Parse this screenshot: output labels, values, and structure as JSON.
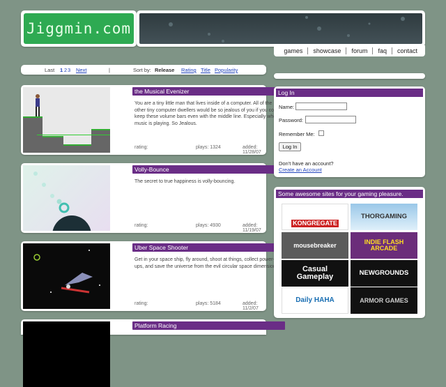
{
  "header": {
    "logo": "Jiggmin.com",
    "nav": [
      "games",
      "showcase",
      "forum",
      "faq",
      "contact"
    ]
  },
  "sortbar": {
    "last": "Last",
    "pages": [
      "1",
      "2",
      "3"
    ],
    "next": "Next",
    "divider": "|",
    "sort_by": "Sort by:",
    "options": [
      "Release",
      "Rating",
      "Title",
      "Popularity"
    ]
  },
  "games": [
    {
      "title": "the Musical Evenizer",
      "description": "You are a tiny little man that lives inside of a computer. All of the other tiny computer dwellers would be so jealous of you if you could keep these volume bars even with the middle line. Especially when music is playing. So Jealous.",
      "rating": "rating:",
      "plays": "plays: 1324",
      "added": "added: 11/28/07"
    },
    {
      "title": "Volly-Bounce",
      "description": "The secret to true happiness is volly-bouncing.",
      "rating": "rating:",
      "plays": "plays: 4930",
      "added": "added: 11/19/07"
    },
    {
      "title": "Uber Space Shooter",
      "description": "Get in your space ship, fly around, shoot at things, collect power-ups, and save the universe from the evil circular space dimension.",
      "rating": "rating:",
      "plays": "plays: 5184",
      "added": "added: 11/2/07"
    },
    {
      "title": "Platform Racing"
    }
  ],
  "login": {
    "title": "Log In",
    "name_label": "Name:",
    "password_label": "Password:",
    "remember_label": "Remember Me:",
    "button": "Log In",
    "no_account": "Don't have an account?",
    "create": "Create an Account"
  },
  "sites": {
    "title": "Some awesome sites for your gaming pleasure.",
    "items": [
      "KONGREGATE",
      "THORGAMING",
      "mousebreaker",
      "INDIE FLASH ARCADE",
      "Casual Gameplay",
      "NEWGROUNDS",
      "Daily HAHA",
      "ARMOR GAMES"
    ]
  }
}
